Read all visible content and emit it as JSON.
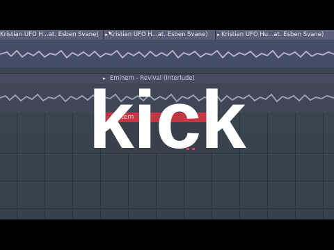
{
  "track1": {
    "clips": [
      {
        "label": "Kristian UFO H...at. Esben Svane)"
      },
      {
        "label": "Kristian UFO H...at. Esben Svane)"
      },
      {
        "label": "Kristian UFO Hu...at. Esben Svane)"
      }
    ]
  },
  "track2": {
    "label": "Eminem - Revival (Interlude)"
  },
  "pattern": {
    "label": "Pattern"
  },
  "overlay": {
    "caption": "kick"
  },
  "colors": {
    "clip_header": "#5a5f78",
    "pattern_clip": "#c53843",
    "background_grid": "#36414b",
    "overlay_text": "#ffffff"
  },
  "icons": [
    "clip-arrow-icon",
    "mouse-cursor-icon"
  ]
}
